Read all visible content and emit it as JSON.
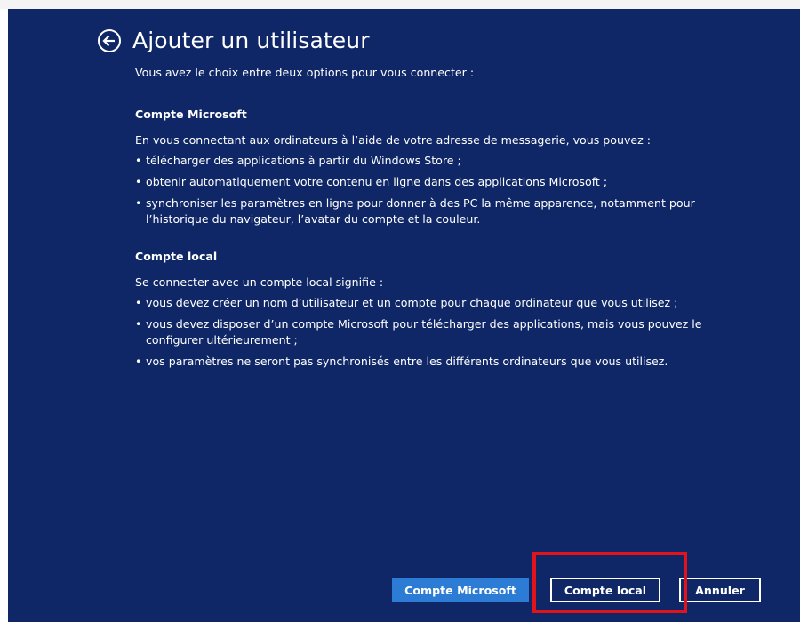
{
  "window": {
    "title": "Ajouter un utilisateur",
    "back_icon": "back-arrow-circle-icon"
  },
  "intro": "Vous avez le choix entre deux options pour vous connecter :",
  "sections": [
    {
      "heading": "Compte Microsoft",
      "description": "En vous connectant aux ordinateurs à l’aide de votre adresse de messagerie, vous pouvez :",
      "bullets": [
        "télécharger des applications à partir du Windows Store ;",
        "obtenir automatiquement votre contenu en ligne dans des applications Microsoft ;",
        "synchroniser les paramètres en ligne pour donner à des PC la même apparence, notamment pour l’historique du navigateur, l’avatar du compte et la couleur."
      ]
    },
    {
      "heading": "Compte local",
      "description": "Se connecter avec un compte local signifie :",
      "bullets": [
        "vous devez créer un nom d’utilisateur et un compte pour chaque ordinateur que vous utilisez ;",
        "vous devez disposer d’un compte Microsoft pour télécharger des applications, mais vous pouvez le configurer ultérieurement ;",
        "vos paramètres ne seront pas synchronisés entre les différents ordinateurs que vous utilisez."
      ]
    }
  ],
  "buttons": {
    "microsoft_account": "Compte Microsoft",
    "local_account": "Compte local",
    "cancel": "Annuler"
  },
  "colors": {
    "background": "#0f2767",
    "primary_button": "#2c7cd5",
    "highlight": "#e3131b",
    "text": "#ffffff"
  }
}
